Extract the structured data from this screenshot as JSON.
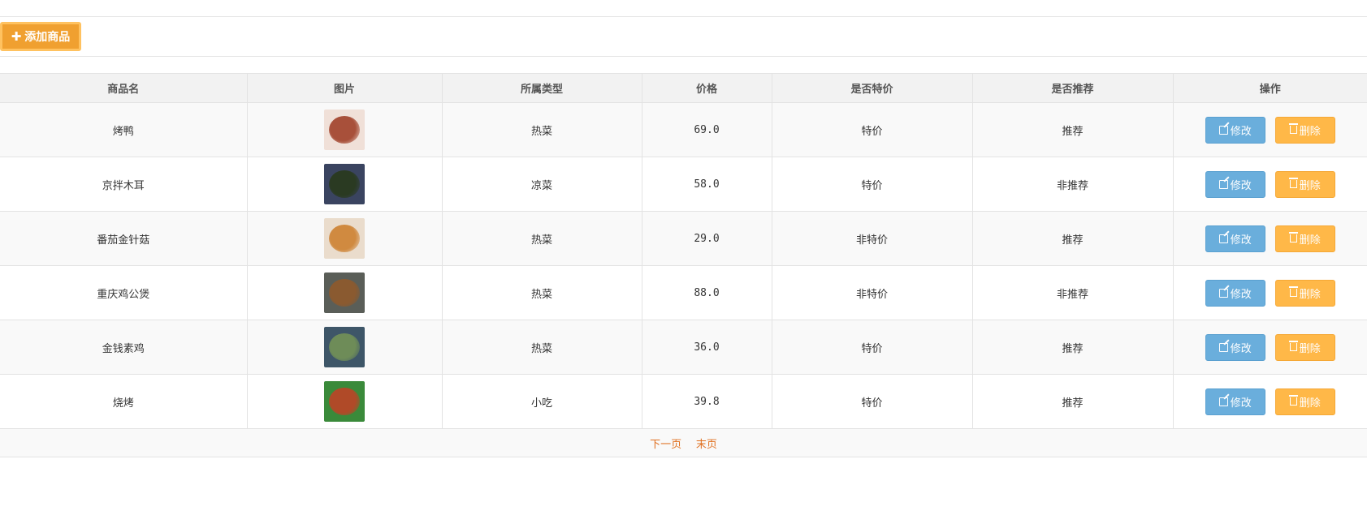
{
  "toolbar": {
    "add_label": "添加商品",
    "add_icon": "plus-icon"
  },
  "table": {
    "headers": [
      "商品名",
      "图片",
      "所属类型",
      "价格",
      "是否特价",
      "是否推荐",
      "操作"
    ],
    "rows": [
      {
        "name": "烤鸭",
        "type": "热菜",
        "price": "69.0",
        "special": "特价",
        "recommend": "推荐",
        "img_colors": [
          "#f0e0d8",
          "#a8503a"
        ]
      },
      {
        "name": "京拌木耳",
        "type": "凉菜",
        "price": "58.0",
        "special": "特价",
        "recommend": "非推荐",
        "img_colors": [
          "#3a4460",
          "#2a3a22"
        ]
      },
      {
        "name": "番茄金针菇",
        "type": "热菜",
        "price": "29.0",
        "special": "非特价",
        "recommend": "推荐",
        "img_colors": [
          "#eadccc",
          "#d08a40"
        ]
      },
      {
        "name": "重庆鸡公煲",
        "type": "热菜",
        "price": "88.0",
        "special": "非特价",
        "recommend": "非推荐",
        "img_colors": [
          "#5a5e58",
          "#8a5a30"
        ]
      },
      {
        "name": "金钱素鸡",
        "type": "热菜",
        "price": "36.0",
        "special": "特价",
        "recommend": "推荐",
        "img_colors": [
          "#3e5668",
          "#6e8c58"
        ]
      },
      {
        "name": "烧烤",
        "type": "小吃",
        "price": "39.8",
        "special": "特价",
        "recommend": "推荐",
        "img_colors": [
          "#3a8a3a",
          "#b04a28"
        ]
      }
    ],
    "actions": {
      "edit_label": "修改",
      "delete_label": "删除"
    }
  },
  "pagination": {
    "next_label": "下一页",
    "last_label": "末页"
  },
  "colors": {
    "edit_button": "#6aaedc",
    "delete_button": "#ffb848",
    "add_button": "#f0a030",
    "pager_link": "#e07020"
  }
}
